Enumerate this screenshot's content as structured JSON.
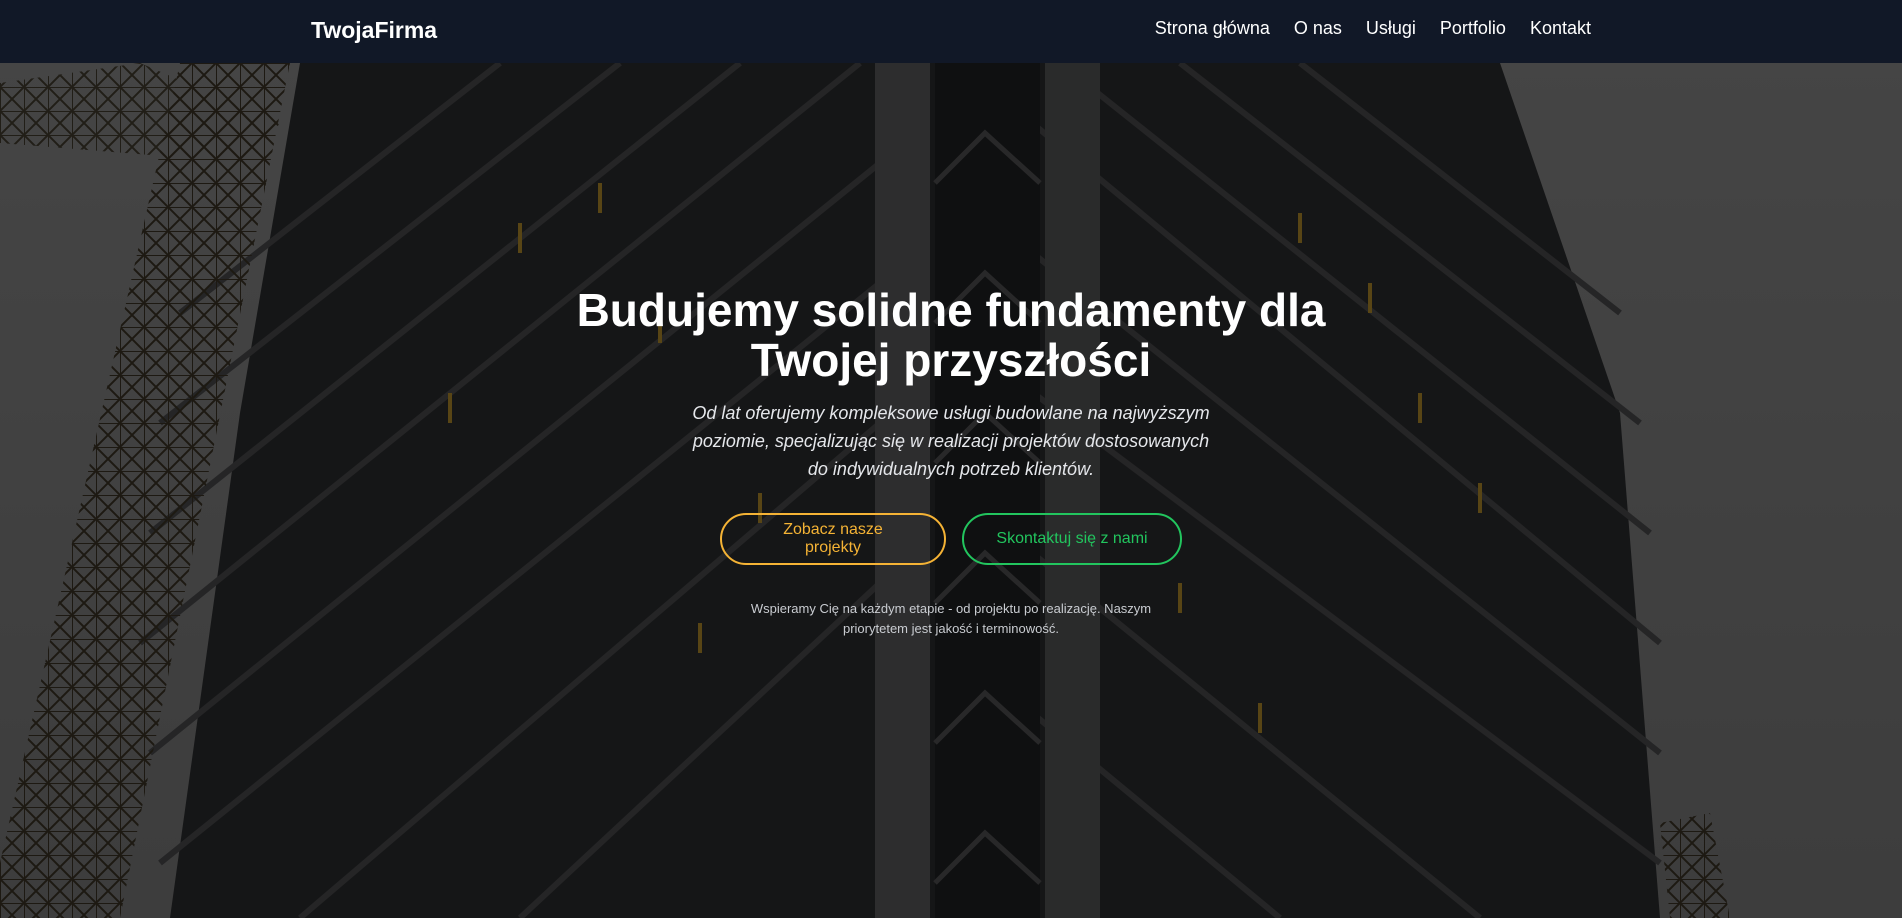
{
  "nav": {
    "brand": "TwojaFirma",
    "links": [
      "Strona główna",
      "O nas",
      "Usługi",
      "Portfolio",
      "Kontakt"
    ]
  },
  "hero": {
    "title": "Budujemy solidne fundamenty dla Twojej przyszłości",
    "subtitle": "Od lat oferujemy kompleksowe usługi budowlane na najwyższym poziomie, specjalizując się w realizacji projektów dostosowanych do indywidualnych potrzeb klientów.",
    "primary_button": "Zobacz nasze projekty",
    "secondary_button": "Skontaktuj się z nami",
    "note": "Wspieramy Cię na każdym etapie - od projektu po realizację. Naszym priorytetem jest jakość i terminowość."
  },
  "colors": {
    "navbar_bg": "#111827",
    "primary_accent": "#f5b335",
    "secondary_accent": "#22c55e",
    "text": "#ffffff"
  }
}
